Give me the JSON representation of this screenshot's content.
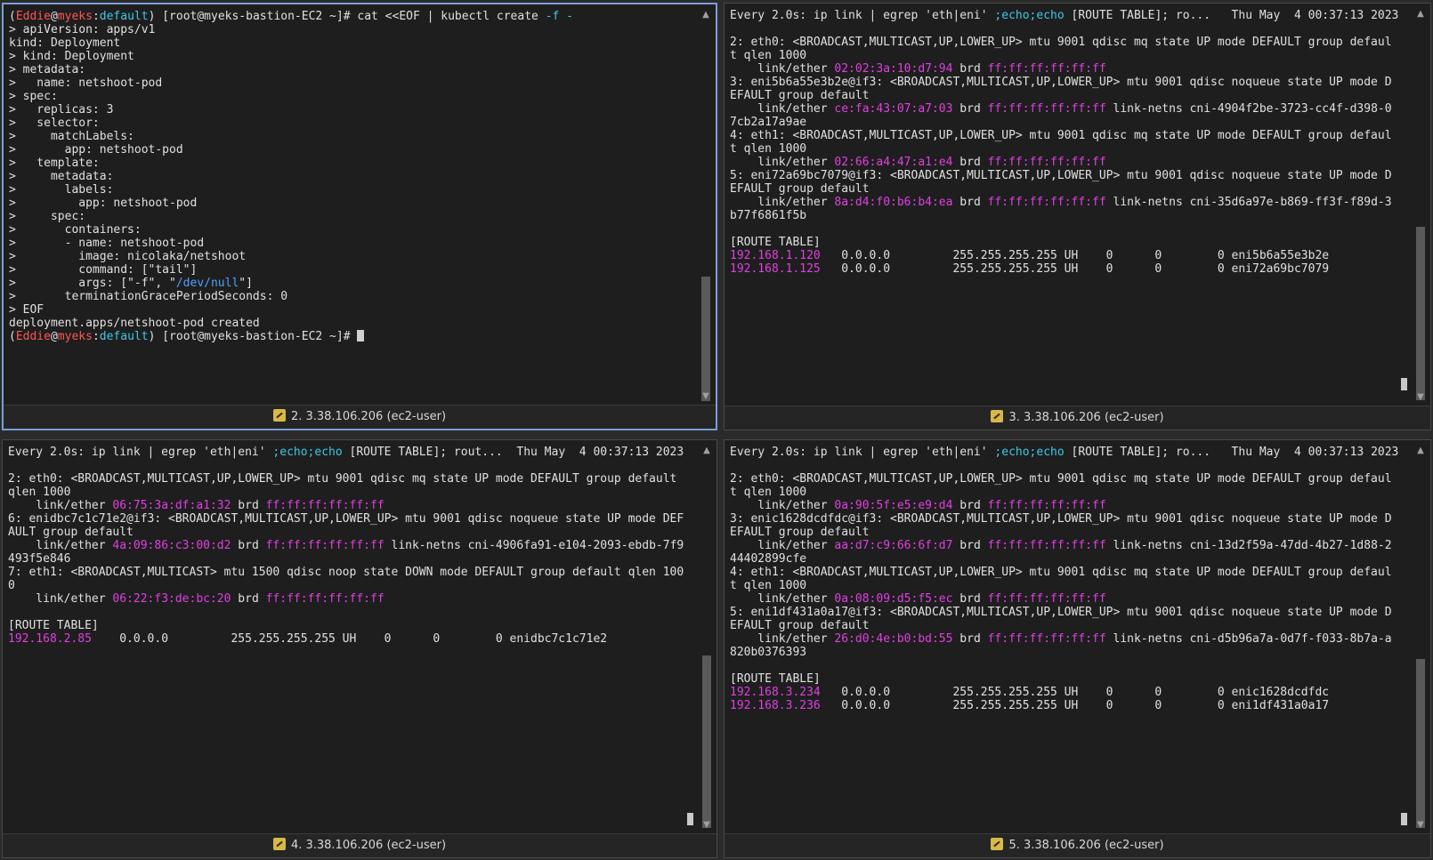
{
  "panes": [
    {
      "status": "2. 3.38.106.206 (ec2-user)",
      "lines": [
        [
          [
            "(",
            ""
          ],
          [
            "Eddie",
            "red"
          ],
          [
            "@",
            ""
          ],
          [
            "myeks",
            "red"
          ],
          [
            ":",
            ""
          ],
          [
            "default",
            "cyan"
          ],
          [
            ") [root@myeks-bastion-EC2 ~]# cat <<EOF | kubectl create ",
            ""
          ],
          [
            "-f -",
            "cyan"
          ]
        ],
        [
          [
            "> apiVersion: apps/v1",
            ""
          ]
        ],
        [
          [
            "kind: Deployment",
            ""
          ]
        ],
        [
          [
            "> kind: Deployment",
            ""
          ]
        ],
        [
          [
            "> metadata:",
            ""
          ]
        ],
        [
          [
            ">   name: netshoot-pod",
            ""
          ]
        ],
        [
          [
            "> spec:",
            ""
          ]
        ],
        [
          [
            ">   replicas: 3",
            ""
          ]
        ],
        [
          [
            ">   selector:",
            ""
          ]
        ],
        [
          [
            ">     matchLabels:",
            ""
          ]
        ],
        [
          [
            ">       app: netshoot-pod",
            ""
          ]
        ],
        [
          [
            ">   template:",
            ""
          ]
        ],
        [
          [
            ">     metadata:",
            ""
          ]
        ],
        [
          [
            ">       labels:",
            ""
          ]
        ],
        [
          [
            ">         app: netshoot-pod",
            ""
          ]
        ],
        [
          [
            ">     spec:",
            ""
          ]
        ],
        [
          [
            ">       containers:",
            ""
          ]
        ],
        [
          [
            ">       - name: netshoot-pod",
            ""
          ]
        ],
        [
          [
            ">         image: nicolaka/netshoot",
            ""
          ]
        ],
        [
          [
            ">         command: [\"tail\"]",
            ""
          ]
        ],
        [
          [
            ">         args: [\"-f\", \"",
            ""
          ],
          [
            "/dev/null",
            "blue"
          ],
          [
            "\"]",
            ""
          ]
        ],
        [
          [
            ">       terminationGracePeriodSeconds: 0",
            ""
          ]
        ],
        [
          [
            "> EOF",
            ""
          ]
        ],
        [
          [
            "deployment.apps/netshoot-pod created",
            ""
          ]
        ],
        [
          [
            "(",
            ""
          ],
          [
            "Eddie",
            "red"
          ],
          [
            "@",
            ""
          ],
          [
            "myeks",
            "red"
          ],
          [
            ":",
            ""
          ],
          [
            "default",
            "cyan"
          ],
          [
            ") [root@myeks-bastion-EC2 ~]# ",
            ""
          ]
        ]
      ]
    },
    {
      "status": "3. 3.38.106.206 (ec2-user)",
      "lines": [
        [
          [
            "Every 2.0s: ip link | egrep 'eth|eni' ",
            ""
          ],
          [
            ";echo;echo",
            "cyan"
          ],
          [
            " [ROUTE TABLE]; ro...   Thu May  4 00:37:13 2023",
            ""
          ]
        ],
        [
          [
            "",
            ""
          ]
        ],
        [
          [
            "2: eth0: <BROADCAST,MULTICAST,UP,LOWER_UP> mtu 9001 qdisc mq state UP mode DEFAULT group defaul",
            ""
          ]
        ],
        [
          [
            "t qlen 1000",
            ""
          ]
        ],
        [
          [
            "    link/ether ",
            ""
          ],
          [
            "02:02:3a:10:d7:94",
            "mag"
          ],
          [
            " brd ",
            ""
          ],
          [
            "ff:ff:ff:ff:ff:ff",
            "mag"
          ]
        ],
        [
          [
            "3: eni5b6a55e3b2e@if3: <BROADCAST,MULTICAST,UP,LOWER_UP> mtu 9001 qdisc noqueue state UP mode D",
            ""
          ]
        ],
        [
          [
            "EFAULT group default",
            ""
          ]
        ],
        [
          [
            "    link/ether ",
            ""
          ],
          [
            "ce:fa:43:07:a7:03",
            "mag"
          ],
          [
            " brd ",
            ""
          ],
          [
            "ff:ff:ff:ff:ff:ff",
            "mag"
          ],
          [
            " link-netns cni-4904f2be-3723-cc4f-d398-0",
            ""
          ]
        ],
        [
          [
            "7cb2a17a9ae",
            ""
          ]
        ],
        [
          [
            "4: eth1: <BROADCAST,MULTICAST,UP,LOWER_UP> mtu 9001 qdisc mq state UP mode DEFAULT group defaul",
            ""
          ]
        ],
        [
          [
            "t qlen 1000",
            ""
          ]
        ],
        [
          [
            "    link/ether ",
            ""
          ],
          [
            "02:66:a4:47:a1:e4",
            "mag"
          ],
          [
            " brd ",
            ""
          ],
          [
            "ff:ff:ff:ff:ff:ff",
            "mag"
          ]
        ],
        [
          [
            "5: eni72a69bc7079@if3: <BROADCAST,MULTICAST,UP,LOWER_UP> mtu 9001 qdisc noqueue state UP mode D",
            ""
          ]
        ],
        [
          [
            "EFAULT group default",
            ""
          ]
        ],
        [
          [
            "    link/ether ",
            ""
          ],
          [
            "8a:d4:f0:b6:b4:ea",
            "mag"
          ],
          [
            " brd ",
            ""
          ],
          [
            "ff:ff:ff:ff:ff:ff",
            "mag"
          ],
          [
            " link-netns cni-35d6a97e-b869-ff3f-f89d-3",
            ""
          ]
        ],
        [
          [
            "b77f6861f5b",
            ""
          ]
        ],
        [
          [
            "",
            ""
          ]
        ],
        [
          [
            "[ROUTE TABLE]",
            ""
          ]
        ],
        [
          [
            "192.168.1.120",
            "mag"
          ],
          [
            "   0.0.0.0         255.255.255.255 UH    0      0        0 eni5b6a55e3b2e",
            ""
          ]
        ],
        [
          [
            "192.168.1.125",
            "mag"
          ],
          [
            "   0.0.0.0         255.255.255.255 UH    0      0        0 eni72a69bc7079",
            ""
          ]
        ]
      ]
    },
    {
      "status": "4. 3.38.106.206 (ec2-user)",
      "lines": [
        [
          [
            "Every 2.0s: ip link | egrep 'eth|eni' ",
            ""
          ],
          [
            ";echo;echo",
            "cyan"
          ],
          [
            " [ROUTE TABLE]; rout...  Thu May  4 00:37:13 2023",
            ""
          ]
        ],
        [
          [
            "",
            ""
          ]
        ],
        [
          [
            "2: eth0: <BROADCAST,MULTICAST,UP,LOWER_UP> mtu 9001 qdisc mq state UP mode DEFAULT group default",
            ""
          ]
        ],
        [
          [
            "qlen 1000",
            ""
          ]
        ],
        [
          [
            "    link/ether ",
            ""
          ],
          [
            "06:75:3a:df:a1:32",
            "mag"
          ],
          [
            " brd ",
            ""
          ],
          [
            "ff:ff:ff:ff:ff:ff",
            "mag"
          ]
        ],
        [
          [
            "6: enidbc7c1c71e2@if3: <BROADCAST,MULTICAST,UP,LOWER_UP> mtu 9001 qdisc noqueue state UP mode DEF",
            ""
          ]
        ],
        [
          [
            "AULT group default",
            ""
          ]
        ],
        [
          [
            "    link/ether ",
            ""
          ],
          [
            "4a:09:86:c3:00:d2",
            "mag"
          ],
          [
            " brd ",
            ""
          ],
          [
            "ff:ff:ff:ff:ff:ff",
            "mag"
          ],
          [
            " link-netns cni-4906fa91-e104-2093-ebdb-7f9",
            ""
          ]
        ],
        [
          [
            "493f5e846",
            ""
          ]
        ],
        [
          [
            "7: eth1: <BROADCAST,MULTICAST> mtu 1500 qdisc noop state DOWN mode DEFAULT group default qlen 100",
            ""
          ]
        ],
        [
          [
            "0",
            ""
          ]
        ],
        [
          [
            "    link/ether ",
            ""
          ],
          [
            "06:22:f3:de:bc:20",
            "mag"
          ],
          [
            " brd ",
            ""
          ],
          [
            "ff:ff:ff:ff:ff:ff",
            "mag"
          ]
        ],
        [
          [
            "",
            ""
          ]
        ],
        [
          [
            "[ROUTE TABLE]",
            ""
          ]
        ],
        [
          [
            "192.168.2.85",
            "mag"
          ],
          [
            "    0.0.0.0         255.255.255.255 UH    0      0        0 enidbc7c1c71e2",
            ""
          ]
        ]
      ]
    },
    {
      "status": "5. 3.38.106.206 (ec2-user)",
      "lines": [
        [
          [
            "Every 2.0s: ip link | egrep 'eth|eni' ",
            ""
          ],
          [
            ";echo;echo",
            "cyan"
          ],
          [
            " [ROUTE TABLE]; ro...   Thu May  4 00:37:13 2023",
            ""
          ]
        ],
        [
          [
            "",
            ""
          ]
        ],
        [
          [
            "2: eth0: <BROADCAST,MULTICAST,UP,LOWER_UP> mtu 9001 qdisc mq state UP mode DEFAULT group defaul",
            ""
          ]
        ],
        [
          [
            "t qlen 1000",
            ""
          ]
        ],
        [
          [
            "    link/ether ",
            ""
          ],
          [
            "0a:90:5f:e5:e9:d4",
            "mag"
          ],
          [
            " brd ",
            ""
          ],
          [
            "ff:ff:ff:ff:ff:ff",
            "mag"
          ]
        ],
        [
          [
            "3: enic1628dcdfdc@if3: <BROADCAST,MULTICAST,UP,LOWER_UP> mtu 9001 qdisc noqueue state UP mode D",
            ""
          ]
        ],
        [
          [
            "EFAULT group default",
            ""
          ]
        ],
        [
          [
            "    link/ether ",
            ""
          ],
          [
            "aa:d7:c9:66:6f:d7",
            "mag"
          ],
          [
            " brd ",
            ""
          ],
          [
            "ff:ff:ff:ff:ff:ff",
            "mag"
          ],
          [
            " link-netns cni-13d2f59a-47dd-4b27-1d88-2",
            ""
          ]
        ],
        [
          [
            "44402899cfe",
            ""
          ]
        ],
        [
          [
            "4: eth1: <BROADCAST,MULTICAST,UP,LOWER_UP> mtu 9001 qdisc mq state UP mode DEFAULT group defaul",
            ""
          ]
        ],
        [
          [
            "t qlen 1000",
            ""
          ]
        ],
        [
          [
            "    link/ether ",
            ""
          ],
          [
            "0a:08:09:d5:f5:ec",
            "mag"
          ],
          [
            " brd ",
            ""
          ],
          [
            "ff:ff:ff:ff:ff:ff",
            "mag"
          ]
        ],
        [
          [
            "5: eni1df431a0a17@if3: <BROADCAST,MULTICAST,UP,LOWER_UP> mtu 9001 qdisc noqueue state UP mode D",
            ""
          ]
        ],
        [
          [
            "EFAULT group default",
            ""
          ]
        ],
        [
          [
            "    link/ether ",
            ""
          ],
          [
            "26:d0:4e:b0:bd:55",
            "mag"
          ],
          [
            " brd ",
            ""
          ],
          [
            "ff:ff:ff:ff:ff:ff",
            "mag"
          ],
          [
            " link-netns cni-d5b96a7a-0d7f-f033-8b7a-a",
            ""
          ]
        ],
        [
          [
            "820b0376393",
            ""
          ]
        ],
        [
          [
            "",
            ""
          ]
        ],
        [
          [
            "[ROUTE TABLE]",
            ""
          ]
        ],
        [
          [
            "192.168.3.234",
            "mag"
          ],
          [
            "   0.0.0.0         255.255.255.255 UH    0      0        0 enic1628dcdfdc",
            ""
          ]
        ],
        [
          [
            "192.168.3.236",
            "mag"
          ],
          [
            "   0.0.0.0         255.255.255.255 UH    0      0        0 eni1df431a0a17",
            ""
          ]
        ]
      ]
    }
  ]
}
